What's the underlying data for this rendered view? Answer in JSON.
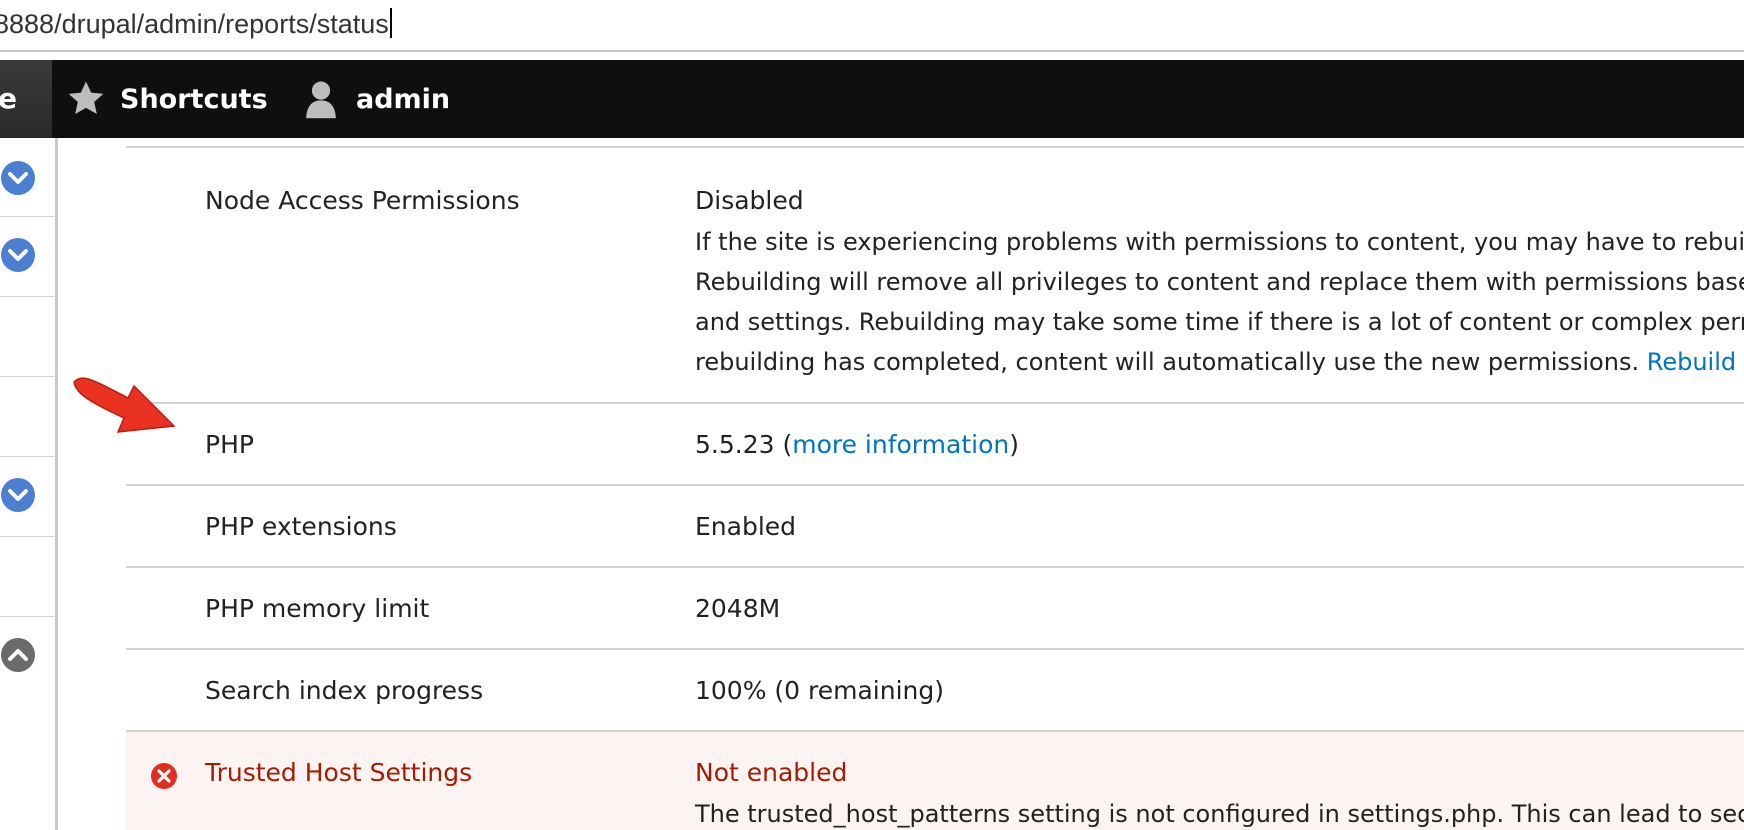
{
  "browser": {
    "url": "8888/drupal/admin/reports/status"
  },
  "toolbar": {
    "home_label": "e",
    "shortcuts_label": "Shortcuts",
    "user_label": "admin"
  },
  "status_rows": [
    {
      "label": "Node Access Permissions",
      "value": "Disabled",
      "description": [
        "If the site is experiencing problems with permissions to content, you may have to rebui",
        "Rebuilding will remove all privileges to content and replace them with permissions base",
        "and settings. Rebuilding may take some time if there is a lot of content or complex perr",
        "rebuilding has completed, content will automatically use the new permissions. "
      ],
      "link": "Rebuild p"
    },
    {
      "label": "PHP",
      "value_prefix": "5.5.23 (",
      "value_link": "more information",
      "value_suffix": ")"
    },
    {
      "label": "PHP extensions",
      "value": "Enabled"
    },
    {
      "label": "PHP memory limit",
      "value": "2048M"
    },
    {
      "label": "Search index progress",
      "value": "100% (0 remaining)"
    },
    {
      "label": "Trusted Host Settings",
      "value": "Not enabled",
      "status": "error",
      "description": [
        "The trusted_host_patterns setting is not configured in settings.php. This can lead to sec"
      ]
    }
  ],
  "colors": {
    "toolbar_bg": "#0f0f0f",
    "link": "#0074bd",
    "error_text": "#a51b00",
    "error_bg": "#fcf4f2",
    "chevron_blue": "#4a7fd1",
    "chevron_gray": "#6b6b6b",
    "arrow_red": "#e8311e"
  }
}
